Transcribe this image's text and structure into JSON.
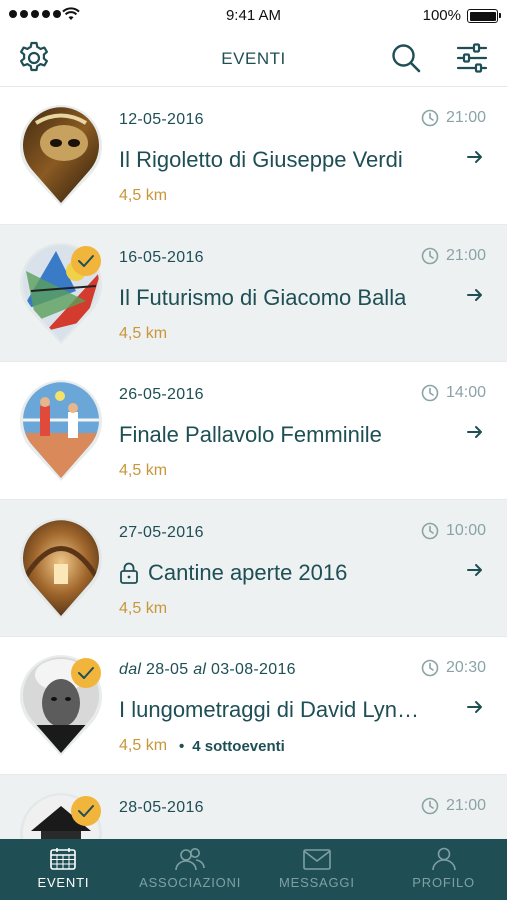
{
  "status_bar": {
    "time": "9:41 AM",
    "battery": "100%"
  },
  "header": {
    "title": "EVENTI"
  },
  "events": [
    {
      "date": "12-05-2016",
      "time": "21:00",
      "title": "Il Rigoletto di Giuseppe Verdi",
      "distance": "4,5 km",
      "checked": false,
      "locked": false
    },
    {
      "date": "16-05-2016",
      "time": "21:00",
      "title": "Il Futurismo di Giacomo Balla",
      "distance": "4,5 km",
      "checked": true,
      "locked": false
    },
    {
      "date": "26-05-2016",
      "time": "14:00",
      "title": "Finale Pallavolo Femminile",
      "distance": "4,5 km",
      "checked": false,
      "locked": false
    },
    {
      "date": "27-05-2016",
      "time": "10:00",
      "title": "Cantine aperte 2016",
      "distance": "4,5 km",
      "checked": false,
      "locked": true
    },
    {
      "date_prefix": "dal",
      "date_start": "28-05",
      "date_mid": "al",
      "date_end": "03-08-2016",
      "time": "20:30",
      "title": "I lungometraggi di David Lyn…",
      "distance": "4,5 km",
      "sub_events": "4 sottoeventi",
      "checked": true,
      "locked": false
    },
    {
      "date": "28-05-2016",
      "time": "21:00",
      "title": "",
      "distance": "",
      "checked": true,
      "locked": false
    }
  ],
  "tabs": [
    {
      "label": "EVENTI",
      "icon": "calendar-icon",
      "active": true
    },
    {
      "label": "ASSOCIAZIONI",
      "icon": "people-icon",
      "active": false
    },
    {
      "label": "MESSAGGI",
      "icon": "envelope-icon",
      "active": false
    },
    {
      "label": "PROFILO",
      "icon": "person-icon",
      "active": false
    }
  ],
  "colors": {
    "brand": "#1f4f55",
    "distance": "#c9963a",
    "check_badge": "#f2b53b",
    "time_gray": "#8aa3a5",
    "alt_row": "#eef1f2"
  }
}
